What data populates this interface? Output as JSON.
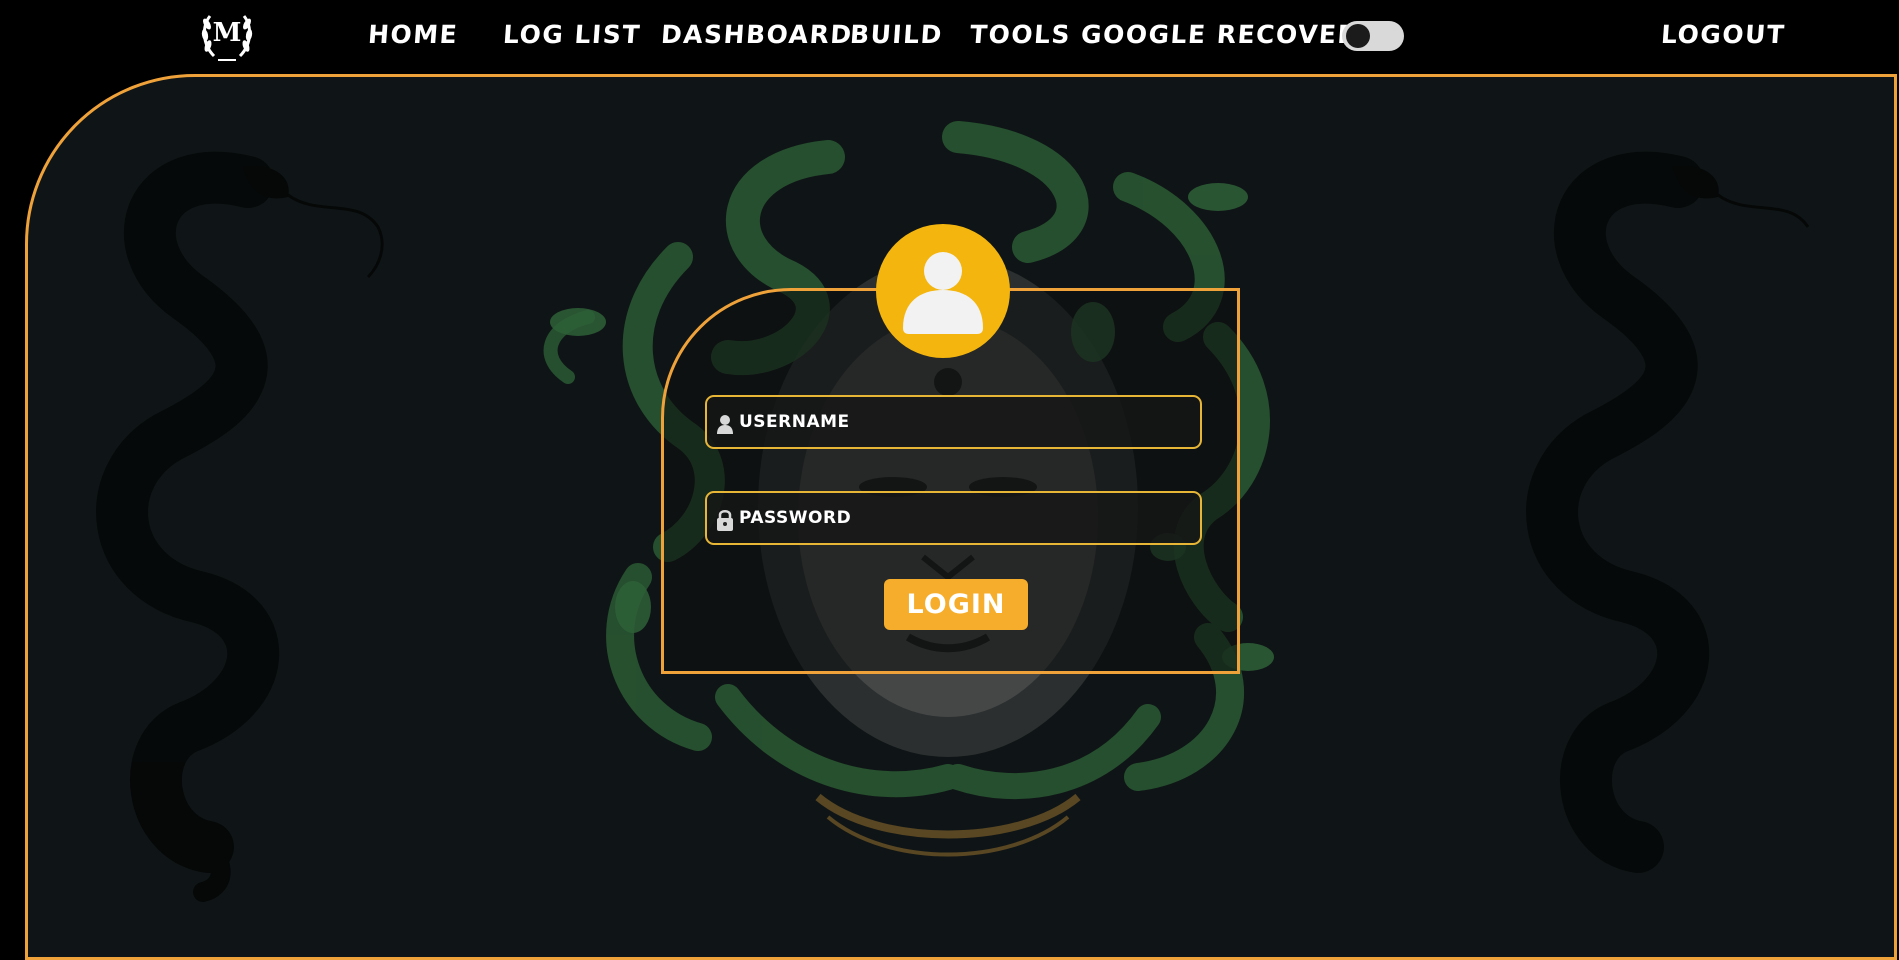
{
  "brand": {
    "logo_letter": "M"
  },
  "nav": {
    "home": "HOME",
    "log_list": "LOG LIST",
    "dashboard": "DASHBOARD",
    "build": "BUILD",
    "tools": "TOOLS",
    "google_recovery": "GOOGLE RECOVERY",
    "logout": "LOGOUT",
    "theme_toggle": {
      "state": "off"
    }
  },
  "login": {
    "username_placeholder": "USERNAME",
    "password_placeholder": "PASSWORD",
    "button_label": "LOGIN"
  },
  "icons": {
    "logo": "laurel-m-logo-icon",
    "avatar": "user-avatar-icon",
    "username": "user-icon",
    "password": "lock-icon"
  },
  "colors": {
    "accent": "#f0a23a",
    "avatar_bg": "#f3b50e",
    "button_bg": "#f6ad2b",
    "panel_bg": "#0f1516",
    "page_bg": "#000000"
  }
}
